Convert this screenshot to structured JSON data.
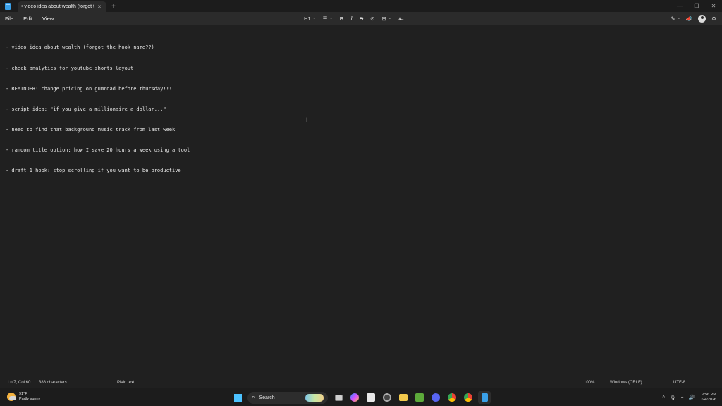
{
  "tab": {
    "title": "• video idea about wealth (forgot t",
    "close": "×",
    "new": "+"
  },
  "window": {
    "minimize": "—",
    "restore": "❐",
    "close": "✕"
  },
  "menu": {
    "file": "File",
    "edit": "Edit",
    "view": "View"
  },
  "toolbar": {
    "heading": "H1",
    "list": "☰",
    "bold": "B",
    "italic": "I",
    "strike": "S",
    "link": "⊘",
    "table": "⊞",
    "clear": "A̶",
    "chevron": "⌄",
    "copilot": "✎",
    "settings": "⚙"
  },
  "editor": {
    "lines": [
      "- video idea about wealth (forgot the hook name??)",
      "- check analytics for youtube shorts layout",
      "- REMINDER: change pricing on gumroad before thursday!!!",
      "- script idea: \"if you give a millionaire a dollar...\"",
      "- need to find that background music track from last week",
      "- random title option: how I save 20 hours a week using a tool",
      "- draft 1 hook: stop scrolling if you want to be productive"
    ]
  },
  "status": {
    "position": "Ln 7, Col 60",
    "characters": "388 characters",
    "format": "Plain text",
    "zoom": "100%",
    "line_ending": "Windows (CRLF)",
    "encoding": "UTF-8"
  },
  "taskbar": {
    "temp": "91°F",
    "weather": "Partly sunny",
    "search_label": "Search",
    "time": "2:56 PM",
    "date": "6/4/2026",
    "tray_up": "^",
    "mic": "🎙",
    "volume": "🔊",
    "network": "⌁"
  },
  "colors": {
    "accent": "#4cc2ff",
    "background": "#202020",
    "chrome": "#2b2b2b",
    "taskbar": "#1c1c1c"
  }
}
